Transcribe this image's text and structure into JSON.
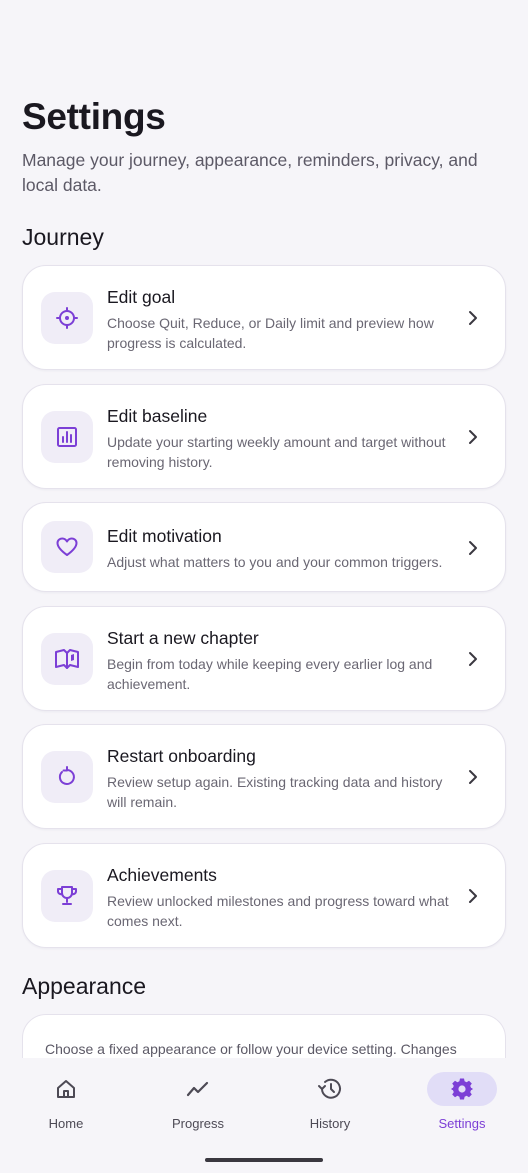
{
  "header": {
    "title": "Settings",
    "subtitle": "Manage your journey, appearance, reminders, privacy, and local data."
  },
  "sections": {
    "journey": "Journey",
    "appearance": "Appearance"
  },
  "journey_items": [
    {
      "title": "Edit goal",
      "desc": "Choose Quit, Reduce, or Daily limit and preview how progress is calculated.",
      "icon": "target-icon"
    },
    {
      "title": "Edit baseline",
      "desc": "Update your starting weekly amount and target without removing history.",
      "icon": "bar-chart-icon"
    },
    {
      "title": "Edit motivation",
      "desc": "Adjust what matters to you and your common triggers.",
      "icon": "heart-icon"
    },
    {
      "title": "Start a new chapter",
      "desc": "Begin from today while keeping every earlier log and achievement.",
      "icon": "book-icon"
    },
    {
      "title": "Restart onboarding",
      "desc": "Review setup again. Existing tracking data and history will remain.",
      "icon": "restart-icon"
    },
    {
      "title": "Achievements",
      "desc": "Review unlocked milestones and progress toward what comes next.",
      "icon": "trophy-icon"
    }
  ],
  "appearance": {
    "desc": "Choose a fixed appearance or follow your device setting. Changes apply"
  },
  "nav": {
    "items": [
      {
        "label": "Home",
        "icon": "home-icon"
      },
      {
        "label": "Progress",
        "icon": "trend-icon"
      },
      {
        "label": "History",
        "icon": "history-icon"
      },
      {
        "label": "Settings",
        "icon": "gear-icon",
        "active": true
      }
    ]
  },
  "colors": {
    "accent": "#7c3fd6",
    "icon_bg": "#f0edf7",
    "active_pill": "#e1ddf7",
    "background": "#f6f5f9"
  }
}
